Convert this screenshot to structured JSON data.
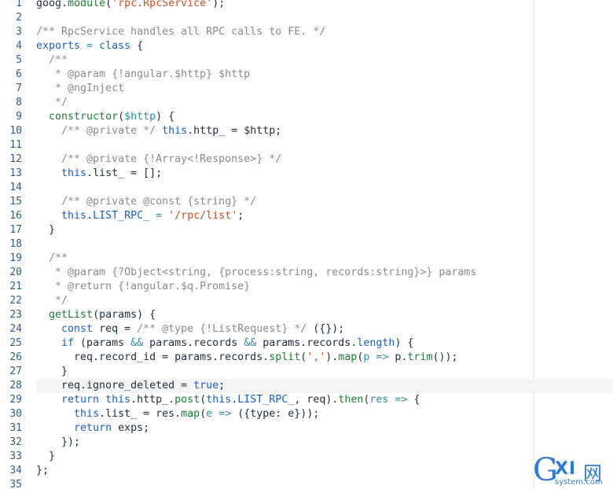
{
  "editor": {
    "line_numbers": [
      "1",
      "2",
      "3",
      "4",
      "5",
      "6",
      "7",
      "8",
      "9",
      "10",
      "11",
      "12",
      "13",
      "14",
      "15",
      "16",
      "17",
      "18",
      "19",
      "20",
      "21",
      "22",
      "23",
      "24",
      "25",
      "26",
      "27",
      "28",
      "29",
      "30",
      "31",
      "32",
      "33",
      "34",
      "35"
    ],
    "active_line": 28,
    "colors": {
      "keyword": "#1d5fbf",
      "comment": "#8a8a8a",
      "string": "#c1542a",
      "function": "#1e7c3a",
      "line_number": "#2f5d8a"
    }
  },
  "code": {
    "l1": [
      "goog",
      ".",
      "module",
      "(",
      "'rpc.RpcService'",
      ");"
    ],
    "l3": "/** RpcService handles all RPC calls to FE. */",
    "l4": [
      "exports",
      " = ",
      "class",
      " {"
    ],
    "l5": "  /**",
    "l6": "   * @param {!angular.$http} $http",
    "l7": "   * @ngInject",
    "l8": "   */",
    "l9": [
      "  ",
      "constructor",
      "(",
      "$http",
      ") {"
    ],
    "l10": [
      "    ",
      "/** @private */",
      " ",
      "this",
      ".http_ = $http;"
    ],
    "l12": "    /** @private {!Array<!Response>} */",
    "l13": [
      "    ",
      "this",
      ".list_ = [];"
    ],
    "l15": "    /** @private @const {string} */",
    "l16": [
      "    ",
      "this",
      ".",
      "LIST_RPC_",
      " = ",
      "'/rpc/list'",
      ";"
    ],
    "l17": "  }",
    "l19": "  /**",
    "l20": "   * @param {?Object<string, {process:string, records:string}>} params",
    "l21": "   * @return {!angular.$q.Promise}",
    "l22": "   */",
    "l23": [
      "  ",
      "getList",
      "(",
      "params",
      ") {"
    ],
    "l24": [
      "    ",
      "const",
      " req = ",
      "/** @type {!ListRequest} */",
      " ({});"
    ],
    "l25": [
      "    ",
      "if",
      " (params ",
      "&&",
      " params.records ",
      "&&",
      " params.records.",
      "length",
      ") {"
    ],
    "l26": [
      "      req.record_id = params.records.",
      "split",
      "(",
      "','",
      ").",
      "map",
      "(",
      "p",
      " ",
      "=>",
      " p.",
      "trim",
      "());"
    ],
    "l27": "    }",
    "l28": [
      "    req.ignore_deleted = ",
      "true",
      ";"
    ],
    "l29": [
      "    ",
      "return",
      " ",
      "this",
      ".http_.",
      "post",
      "(",
      "this",
      ".",
      "LIST_RPC_",
      ", req).",
      "then",
      "(",
      "res",
      " ",
      "=>",
      " {"
    ],
    "l30": [
      "      ",
      "this",
      ".list_ = res.",
      "map",
      "(",
      "e",
      " ",
      "=>",
      " ({type: e}));"
    ],
    "l31": [
      "      ",
      "return",
      " exps;"
    ],
    "l32": "    });",
    "l33": "  }",
    "l34": "};"
  },
  "watermark": {
    "g": "G",
    "xi": "XI",
    "wang": "网",
    "site": "system.com"
  }
}
